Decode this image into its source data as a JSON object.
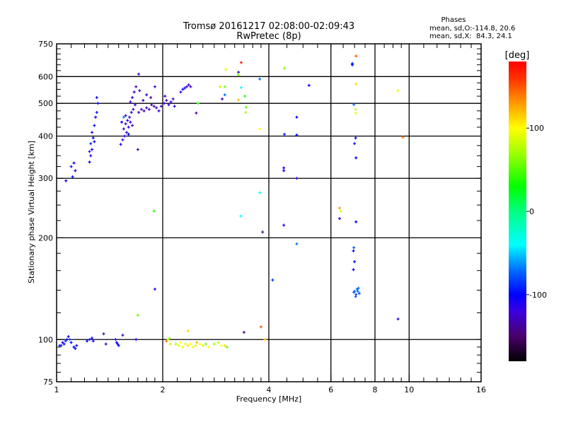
{
  "chart_data": {
    "type": "scatter",
    "title": "Tromsø 20161217 02:08:00-02:09:43",
    "subtitle": "RwPretec (8p)",
    "xlabel": "Frequency [MHz]",
    "ylabel": "Stationary phase Virtual Height [km]",
    "x_scale": "log",
    "y_scale": "log",
    "xlim": [
      1,
      16
    ],
    "ylim": [
      75,
      750
    ],
    "x_ticks": [
      1,
      2,
      4,
      6,
      8,
      10,
      16
    ],
    "y_ticks": [
      75,
      100,
      200,
      300,
      400,
      500,
      600,
      750
    ],
    "x_grid": [
      2,
      4,
      6,
      8,
      10
    ],
    "y_grid": [
      100,
      200,
      300,
      400,
      500,
      600
    ],
    "grid": true,
    "stats": {
      "heading": "Phases",
      "line_o": "mean, sd,O:-114.8, 20.6",
      "line_x": "mean, sd,X:  84.3, 24.1"
    },
    "colorbar": {
      "label": "[deg]",
      "range": [
        -180,
        180
      ],
      "ticks": [
        100,
        0,
        -100
      ],
      "colormap": [
        [
          -180,
          "#000000"
        ],
        [
          -150,
          "#4a006a"
        ],
        [
          -120,
          "#3a00e0"
        ],
        [
          -100,
          "#0000ff"
        ],
        [
          -70,
          "#0070ff"
        ],
        [
          -40,
          "#00ffff"
        ],
        [
          0,
          "#00ff80"
        ],
        [
          30,
          "#00ff00"
        ],
        [
          70,
          "#a0ff00"
        ],
        [
          100,
          "#ffff00"
        ],
        [
          130,
          "#ff9900"
        ],
        [
          160,
          "#ff3000"
        ],
        [
          180,
          "#ff0000"
        ]
      ]
    },
    "point_fields": [
      "frequency_MHz",
      "height_km",
      "phase_deg"
    ],
    "points": [
      [
        1.02,
        96,
        -90
      ],
      [
        1.03,
        96,
        -95
      ],
      [
        1.05,
        97,
        -100
      ],
      [
        1.06,
        99,
        -90
      ],
      [
        1.07,
        100,
        -100
      ],
      [
        1.08,
        102,
        -110
      ],
      [
        1.09,
        100,
        -80
      ],
      [
        1.1,
        98,
        -100
      ],
      [
        1.04,
        98,
        -110
      ],
      [
        1.12,
        95,
        -100
      ],
      [
        1.13,
        94,
        -95
      ],
      [
        1.14,
        96,
        -110
      ],
      [
        1.22,
        99,
        -100
      ],
      [
        1.24,
        100,
        -105
      ],
      [
        1.26,
        101,
        -100
      ],
      [
        1.27,
        99,
        -110
      ],
      [
        1.38,
        97,
        -110
      ],
      [
        1.47,
        100,
        -110
      ],
      [
        1.48,
        98,
        -100
      ],
      [
        1.49,
        97,
        -120
      ],
      [
        1.5,
        96,
        -95
      ],
      [
        1.36,
        104,
        -130
      ],
      [
        1.54,
        103,
        -130
      ],
      [
        1.7,
        118,
        60
      ],
      [
        1.68,
        100,
        -110
      ],
      [
        2.05,
        99,
        140
      ],
      [
        2.07,
        100,
        80
      ],
      [
        2.09,
        101,
        70
      ],
      [
        2.1,
        97,
        110
      ],
      [
        2.18,
        97,
        70
      ],
      [
        2.22,
        96,
        90
      ],
      [
        2.25,
        98,
        100
      ],
      [
        2.28,
        95,
        95
      ],
      [
        2.32,
        97,
        90
      ],
      [
        2.36,
        96,
        110
      ],
      [
        2.4,
        97,
        100
      ],
      [
        2.44,
        95,
        95
      ],
      [
        2.48,
        96,
        85
      ],
      [
        2.5,
        98,
        120
      ],
      [
        2.55,
        97,
        100
      ],
      [
        2.6,
        96,
        90
      ],
      [
        2.65,
        97,
        60
      ],
      [
        2.7,
        95,
        100
      ],
      [
        2.8,
        97,
        70
      ],
      [
        2.88,
        98,
        80
      ],
      [
        2.93,
        96,
        100
      ],
      [
        3.0,
        96,
        110
      ],
      [
        3.04,
        95,
        60
      ],
      [
        2.36,
        106,
        110
      ],
      [
        3.4,
        105,
        -140
      ],
      [
        3.8,
        109,
        150
      ],
      [
        3.9,
        100,
        120
      ],
      [
        1.9,
        141,
        -120
      ],
      [
        1.89,
        240,
        40
      ],
      [
        1.063,
        295,
        -110
      ],
      [
        1.11,
        303,
        -100
      ],
      [
        1.13,
        316,
        -110
      ],
      [
        1.12,
        333,
        -100
      ],
      [
        1.1,
        325,
        -110
      ],
      [
        1.24,
        335,
        -100
      ],
      [
        1.25,
        350,
        -110
      ],
      [
        1.26,
        365,
        -100
      ],
      [
        1.25,
        380,
        -90
      ],
      [
        1.27,
        395,
        -100
      ],
      [
        1.26,
        410,
        -110
      ],
      [
        1.28,
        430,
        -100
      ],
      [
        1.29,
        455,
        -100
      ],
      [
        1.3,
        470,
        -95
      ],
      [
        1.31,
        500,
        -100
      ],
      [
        1.3,
        520,
        -105
      ],
      [
        1.24,
        360,
        -120
      ],
      [
        1.28,
        385,
        -110
      ],
      [
        1.52,
        378,
        -110
      ],
      [
        1.54,
        390,
        -120
      ],
      [
        1.56,
        400,
        -110
      ],
      [
        1.58,
        410,
        -120
      ],
      [
        1.6,
        405,
        -100
      ],
      [
        1.55,
        420,
        -115
      ],
      [
        1.57,
        435,
        -120
      ],
      [
        1.59,
        445,
        -110
      ],
      [
        1.61,
        455,
        -120
      ],
      [
        1.63,
        470,
        -110
      ],
      [
        1.65,
        480,
        -125
      ],
      [
        1.67,
        495,
        -115
      ],
      [
        1.62,
        505,
        -120
      ],
      [
        1.64,
        520,
        -110
      ],
      [
        1.66,
        540,
        -125
      ],
      [
        1.68,
        560,
        -130
      ],
      [
        1.53,
        440,
        -105
      ],
      [
        1.57,
        460,
        -115
      ],
      [
        1.6,
        425,
        -110
      ],
      [
        1.62,
        440,
        -120
      ],
      [
        1.64,
        430,
        -130
      ],
      [
        1.55,
        455,
        -70
      ],
      [
        1.71,
        470,
        -130
      ],
      [
        1.74,
        480,
        -125
      ],
      [
        1.77,
        475,
        -140
      ],
      [
        1.8,
        485,
        -130
      ],
      [
        1.83,
        480,
        -125
      ],
      [
        1.86,
        495,
        -135
      ],
      [
        1.89,
        490,
        -130
      ],
      [
        1.92,
        485,
        -130
      ],
      [
        1.95,
        475,
        -120
      ],
      [
        1.98,
        490,
        -125
      ],
      [
        1.76,
        510,
        -130
      ],
      [
        1.8,
        530,
        -120
      ],
      [
        1.85,
        520,
        -135
      ],
      [
        1.72,
        545,
        -130
      ],
      [
        1.9,
        560,
        -130
      ],
      [
        1.71,
        610,
        -120
      ],
      [
        1.7,
        365,
        -140
      ],
      [
        2.02,
        500,
        -120
      ],
      [
        2.05,
        510,
        -130
      ],
      [
        2.08,
        495,
        -125
      ],
      [
        2.11,
        505,
        -120
      ],
      [
        2.14,
        515,
        -130
      ],
      [
        2.16,
        490,
        -110
      ],
      [
        2.03,
        525,
        -120
      ],
      [
        2.25,
        540,
        -120
      ],
      [
        2.28,
        550,
        -100
      ],
      [
        2.31,
        555,
        -110
      ],
      [
        2.34,
        560,
        -120
      ],
      [
        2.37,
        567,
        -130
      ],
      [
        2.4,
        560,
        -125
      ],
      [
        2.49,
        468,
        -140
      ],
      [
        2.52,
        500,
        40
      ],
      [
        3.34,
        660,
        170
      ],
      [
        3.02,
        630,
        90
      ],
      [
        3.28,
        618,
        -130
      ],
      [
        3.28,
        608,
        60
      ],
      [
        3.77,
        590,
        -70
      ],
      [
        2.91,
        560,
        80
      ],
      [
        3.0,
        560,
        60
      ],
      [
        3.34,
        557,
        -40
      ],
      [
        3.0,
        530,
        -70
      ],
      [
        2.95,
        515,
        -130
      ],
      [
        3.28,
        512,
        120
      ],
      [
        3.42,
        525,
        40
      ],
      [
        3.45,
        487,
        50
      ],
      [
        3.44,
        470,
        70
      ],
      [
        3.77,
        420,
        100
      ],
      [
        4.43,
        635,
        60
      ],
      [
        5.2,
        565,
        -100
      ],
      [
        4.8,
        455,
        -100
      ],
      [
        4.43,
        405,
        -90
      ],
      [
        4.8,
        403,
        -100
      ],
      [
        7.07,
        690,
        150
      ],
      [
        6.9,
        656,
        -90
      ],
      [
        6.9,
        650,
        -100
      ],
      [
        7.07,
        570,
        110
      ],
      [
        6.97,
        496,
        -70
      ],
      [
        7.05,
        480,
        80
      ],
      [
        7.05,
        468,
        90
      ],
      [
        9.3,
        545,
        90
      ],
      [
        7.05,
        395,
        -100
      ],
      [
        9.6,
        397,
        140
      ],
      [
        7.0,
        380,
        -110
      ],
      [
        7.07,
        345,
        -100
      ],
      [
        4.41,
        322,
        -100
      ],
      [
        4.41,
        316,
        -110
      ],
      [
        4.8,
        300,
        -110
      ],
      [
        3.77,
        272,
        -40
      ],
      [
        6.35,
        245,
        130
      ],
      [
        6.4,
        240,
        90
      ],
      [
        3.33,
        232,
        -40
      ],
      [
        6.35,
        228,
        -120
      ],
      [
        7.07,
        223,
        -100
      ],
      [
        4.41,
        218,
        -110
      ],
      [
        3.84,
        208,
        -140
      ],
      [
        4.8,
        192,
        -70
      ],
      [
        6.97,
        187,
        -80
      ],
      [
        6.95,
        183,
        -100
      ],
      [
        7.0,
        170,
        -100
      ],
      [
        6.95,
        161,
        -100
      ],
      [
        4.1,
        150,
        -90
      ],
      [
        9.3,
        115,
        -110
      ],
      [
        6.97,
        138,
        -75
      ],
      [
        7.0,
        139,
        -70
      ],
      [
        7.07,
        136,
        -80
      ],
      [
        7.12,
        141,
        -75
      ],
      [
        7.15,
        139,
        -70
      ],
      [
        7.22,
        137,
        -80
      ],
      [
        7.05,
        134,
        -75
      ],
      [
        7.18,
        142,
        -70
      ]
    ]
  }
}
